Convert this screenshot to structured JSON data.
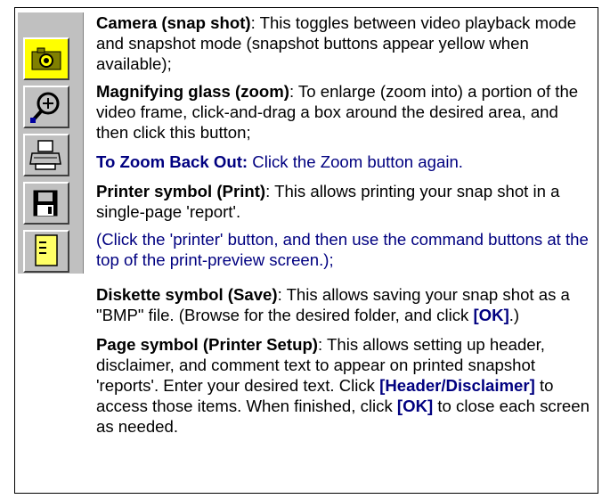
{
  "toolbar": {
    "buttons": [
      {
        "icon": "camera-icon",
        "state": "active-yellow"
      },
      {
        "icon": "magnifier-icon",
        "state": "normal"
      },
      {
        "icon": "printer-icon",
        "state": "normal"
      },
      {
        "icon": "diskette-icon",
        "state": "normal"
      },
      {
        "icon": "page-icon",
        "state": "normal"
      }
    ]
  },
  "camera": {
    "term": "Camera (snap shot)",
    "text": ":  This toggles between video playback mode and snapshot mode (snapshot buttons appear yellow when available);"
  },
  "zoom": {
    "term": "Magnifying glass (zoom)",
    "text": ":  To enlarge (zoom into) a portion of the video frame, click-and-drag a box around the desired area, and then click this button;"
  },
  "zoom_out": {
    "term": "To Zoom Back Out:",
    "text": " Click the Zoom button again."
  },
  "print": {
    "term": "Printer symbol (Print)",
    "text": ":  This allows printing your snap shot in a single-page 'report'.",
    "note": "(Click the 'printer' button, and then use the command buttons at the top of the print-preview screen.);"
  },
  "save": {
    "term": "Diskette symbol (Save)",
    "text1": ":  This allows saving your snap shot as a \"BMP\" file.  (Browse for the desired folder, and click ",
    "ok": "[OK]",
    "text2": ".)"
  },
  "setup": {
    "term": "Page symbol  (Printer Setup)",
    "text1": ":  This allows setting up header, disclaimer, and comment text to appear on printed snapshot 'reports'.  Enter your desired text.  Click ",
    "header_btn": "[Header/Disclaimer]",
    "text2": "  to access those items.  When finished, click ",
    "ok": "[OK]",
    "text3": " to close each screen as needed."
  },
  "colors": {
    "active_button": "#ffff00",
    "toolbar_bg": "#c0c0c0",
    "accent_text": "#000080"
  }
}
